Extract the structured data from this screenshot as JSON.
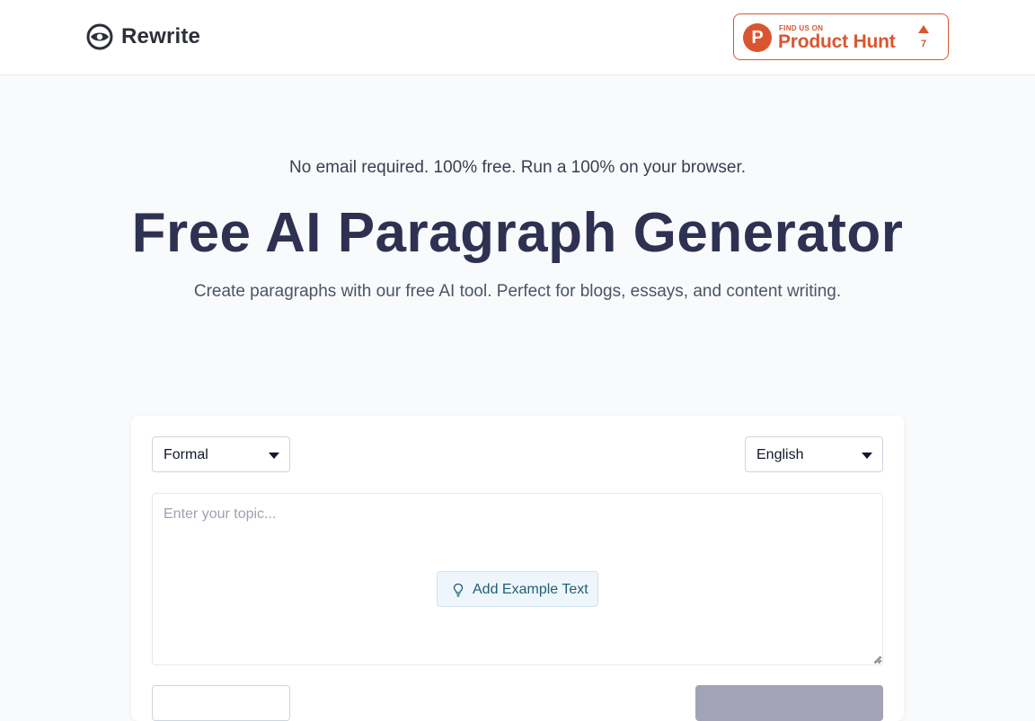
{
  "header": {
    "logo_text": "Rewrite",
    "product_hunt": {
      "small_text": "FIND US ON",
      "name": "Product Hunt",
      "letter": "P",
      "upvotes": "7"
    }
  },
  "hero": {
    "tagline": "No email required. 100% free. Run a 100% on your browser.",
    "title": "Free AI Paragraph Generator",
    "subtitle": "Create paragraphs with our free AI tool. Perfect for blogs, essays, and content writing."
  },
  "tool": {
    "tone_select": {
      "selected": "Formal"
    },
    "language_select": {
      "selected": "English"
    },
    "topic_input": {
      "value": "",
      "placeholder": "Enter your topic..."
    },
    "example_button_label": "Add Example Text"
  },
  "colors": {
    "brand_dark": "#2e3152",
    "product_hunt": "#da552f",
    "example_button_bg": "#eef6fb",
    "generate_button_disabled": "#a3a3b6"
  },
  "icons": {
    "logo": "eye-circle-icon",
    "select": "caret-down-icon",
    "example": "lightbulb-icon",
    "upvote": "triangle-up-icon"
  }
}
